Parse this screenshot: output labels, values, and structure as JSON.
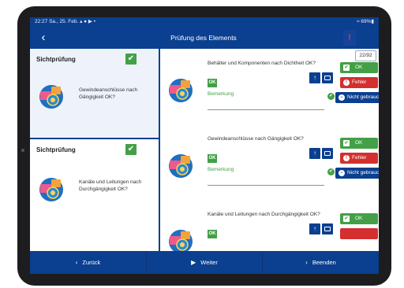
{
  "status": {
    "left": "22:27  Sa., 25. Feb.  ▴ ● ▶ •",
    "right": "≈ 69%▮"
  },
  "appbar": {
    "back_icon": "‹",
    "title": "Prüfung des Elements",
    "alert_icon": "!"
  },
  "sidebar": {
    "cards": [
      {
        "title": "Sichtprüfung",
        "description": "Gewindeanschlüsse nach Gängigkeit OK?"
      },
      {
        "title": "Sichtprüfung",
        "description": "Kanäle und Leitungen nach Durchgängigkeit OK?"
      }
    ]
  },
  "main": {
    "page_count": "22/92",
    "items": [
      {
        "question": "Behälter und Komponenten nach Dichtheit OK?",
        "badge": "OK",
        "remark": "Bemerkung",
        "ok": "OK",
        "error": "Fehler",
        "not_used": "Nicht gebraucht"
      },
      {
        "question": "Gewindeanschlüsse nach Gängigkeit OK?",
        "badge": "OK",
        "remark": "Bemerkung",
        "ok": "OK",
        "error": "Fehler",
        "not_used": "Nicht gebraucht"
      },
      {
        "question": "Kanäle und Leitungen nach Durchgängigkeit OK?",
        "badge": "OK",
        "remark": "",
        "ok": "OK",
        "error": "",
        "not_used": ""
      }
    ]
  },
  "bottom": {
    "back": "Zurück",
    "next": "Weiter",
    "finish": "Beenden"
  },
  "icons": {
    "check": "✔",
    "upload": "↑",
    "exclaim": "!",
    "minus": "−"
  },
  "colors": {
    "primary": "#0b3f8f",
    "success": "#43a047",
    "danger": "#d32f2f"
  }
}
